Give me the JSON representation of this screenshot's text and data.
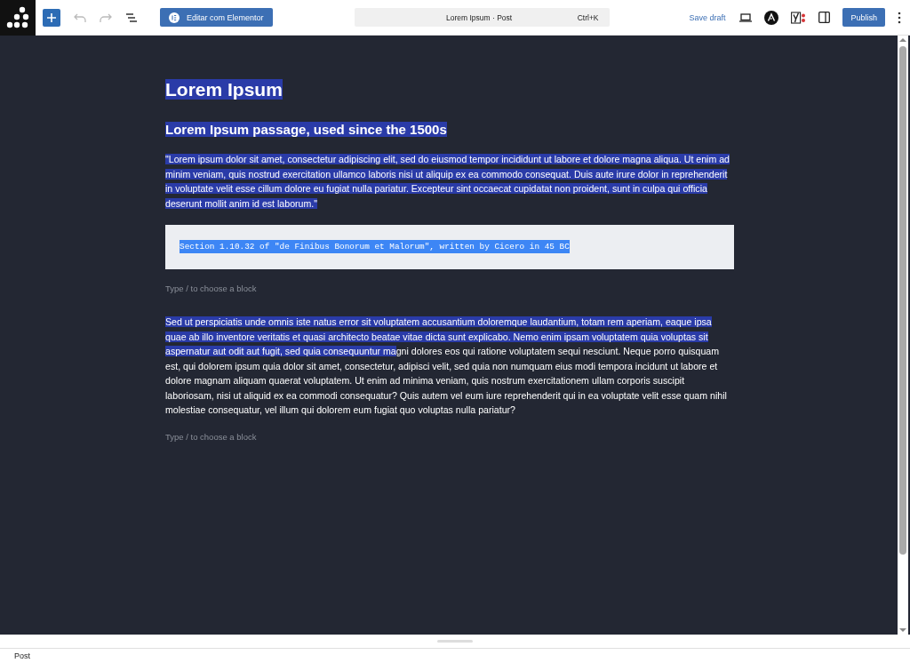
{
  "toolbar": {
    "elementor_button": "Editar com Elementor",
    "command_bar": {
      "title": "Lorem Ipsum · Post",
      "shortcut": "Ctrl+K"
    },
    "save_draft": "Save draft",
    "publish": "Publish"
  },
  "blocks": [
    {
      "kind": "heading1",
      "segments": [
        {
          "text": "Lorem Ipsum",
          "selected": true
        }
      ]
    },
    {
      "kind": "heading2",
      "segments": [
        {
          "text": "Lorem Ipsum passage, used since the 1500s",
          "selected": true
        }
      ]
    },
    {
      "kind": "paragraph",
      "segments": [
        {
          "text": "\"Lorem ipsum dolor sit amet, consectetur adipiscing elit, sed do eiusmod tempor incididunt ut labore et dolore magna aliqua. Ut enim ad minim veniam, quis nostrud exercitation ullamco laboris nisi ut aliquip ex ea commodo consequat. Duis aute irure dolor in reprehenderit in voluptate velit esse cillum dolore eu fugiat nulla pariatur. Excepteur sint occaecat cupidatat non proident, sunt in culpa qui officia deserunt mollit anim id est laborum.\"",
          "selected": true
        }
      ]
    },
    {
      "kind": "code",
      "segments": [
        {
          "text": "Section 1.10.32 of \"de Finibus Bonorum et Malorum\", written by Cicero in 45 BC",
          "selected": true
        }
      ]
    },
    {
      "kind": "appender",
      "placeholder": "Type / to choose a block"
    },
    {
      "kind": "paragraph",
      "segments": [
        {
          "text": "Sed ut perspiciatis unde omnis iste natus error sit voluptatem accusantium doloremque laudantium, totam rem aperiam, eaque ipsa quae ab illo inventore veritatis et quasi architecto beatae vitae dicta sunt explicabo. Nemo enim ipsam voluptatem quia voluptas sit aspernatur aut odit aut fugit, sed quia consequuntur ma",
          "selected": true
        },
        {
          "text": "gni dolores eos qui ratione voluptatem sequi nesciunt. Neque porro quisquam est, qui dolorem ipsum quia dolor sit amet, consectetur, adipisci velit, sed quia non numquam eius modi tempora incidunt ut labore et dolore magnam aliquam quaerat voluptatem. Ut enim ad minima veniam, quis nostrum exercitationem ullam corporis suscipit laboriosam, nisi ut aliquid ex ea commodi consequatur? Quis autem vel eum iure reprehenderit qui in ea voluptate velit esse quam nihil molestiae consequatur, vel illum qui dolorem eum fugiat quo voluptas nulla pariatur?",
          "selected": false
        }
      ]
    },
    {
      "kind": "appender",
      "placeholder": "Type / to choose a block"
    }
  ],
  "status_bar": {
    "breadcrumb": "Post"
  }
}
